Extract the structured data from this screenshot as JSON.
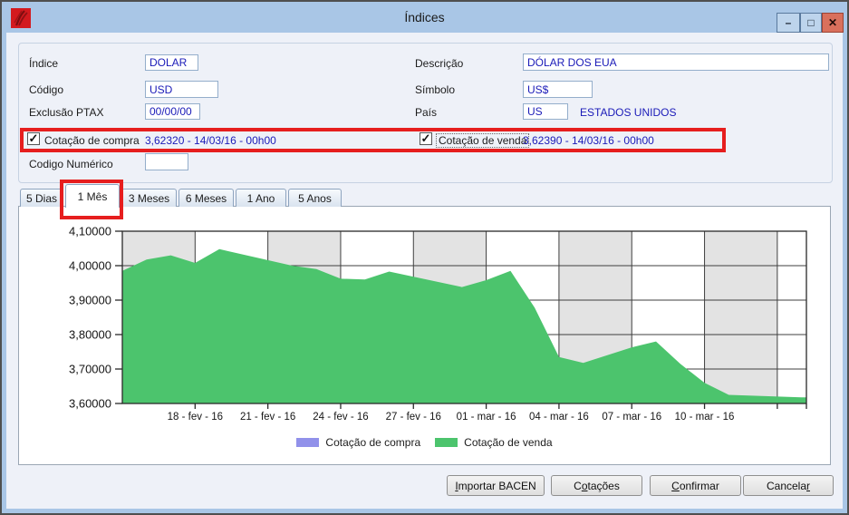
{
  "window": {
    "title": "Índices",
    "icon": "totvs-red-logo",
    "controls": {
      "minimize": "minimize",
      "maximize": "maximize",
      "close": "close"
    }
  },
  "colors": {
    "titlebar": "#a9c6e6",
    "body": "#eef1f8",
    "value_text": "#1a1ab8",
    "highlight_red": "#e61e1e",
    "band_gray": "#e3e3e3",
    "compra_purple": "#9191ea",
    "venda_green": "#4cc46d"
  },
  "form": {
    "indice": {
      "label": "Índice",
      "value": "DOLAR"
    },
    "descricao": {
      "label": "Descrição",
      "value": "DÓLAR DOS EUA"
    },
    "codigo": {
      "label": "Código",
      "value": "USD"
    },
    "simbolo": {
      "label": "Símbolo",
      "value": "US$"
    },
    "exclusao_ptax": {
      "label": "Exclusão PTAX",
      "value": "00/00/00"
    },
    "pais": {
      "label": "País",
      "value": "US",
      "name": "ESTADOS UNIDOS"
    },
    "cotacao_compra": {
      "label": "Cotação de compra",
      "checked": true,
      "value": "3,62320 - 14/03/16 - 00h00"
    },
    "cotacao_venda": {
      "label": "Cotação de venda",
      "checked": true,
      "value": "3,62390 - 14/03/16 - 00h00"
    },
    "codigo_numerico": {
      "label": "Codigo Numérico",
      "value": ""
    }
  },
  "tabs": {
    "items": [
      "5 Dias",
      "1 Mês",
      "3 Meses",
      "6 Meses",
      "1 Ano",
      "5 Anos"
    ],
    "active": "1 Mês"
  },
  "chart_data": {
    "type": "area",
    "title": "",
    "xlabel": "",
    "ylabel": "",
    "ylim": [
      3.6,
      4.1
    ],
    "grid": true,
    "legend_position": "bottom",
    "yticks": [
      {
        "v": 4.1,
        "label": "4,10000"
      },
      {
        "v": 4.0,
        "label": "4,00000"
      },
      {
        "v": 3.9,
        "label": "3,90000"
      },
      {
        "v": 3.8,
        "label": "3,80000"
      },
      {
        "v": 3.7,
        "label": "3,70000"
      },
      {
        "v": 3.6,
        "label": "3,60000"
      }
    ],
    "xticks": [
      {
        "day": 3,
        "label": "18 - fev - 16"
      },
      {
        "day": 6,
        "label": "21 - fev - 16"
      },
      {
        "day": 9,
        "label": "24 - fev - 16"
      },
      {
        "day": 12,
        "label": "27 - fev - 16"
      },
      {
        "day": 15,
        "label": "01 - mar - 16"
      },
      {
        "day": 18,
        "label": "04 - mar - 16"
      },
      {
        "day": 21,
        "label": "07 - mar - 16"
      },
      {
        "day": 24,
        "label": "10 - mar - 16"
      },
      {
        "day": 27,
        "label": ""
      }
    ],
    "day_range": [
      0,
      28.2
    ],
    "gray_bands_days": [
      [
        0,
        3
      ],
      [
        6,
        9
      ],
      [
        12,
        15
      ],
      [
        18,
        21
      ],
      [
        24,
        27
      ]
    ],
    "series": [
      {
        "name": "Cotação de compra",
        "color": "#9191ea",
        "points": [
          [
            0,
            3.983
          ],
          [
            1,
            4.016
          ],
          [
            2,
            4.028
          ],
          [
            3,
            4.006
          ],
          [
            4,
            4.046
          ],
          [
            7,
            3.998
          ],
          [
            8,
            3.988
          ],
          [
            9,
            3.96
          ],
          [
            10,
            3.958
          ],
          [
            11,
            3.981
          ],
          [
            14,
            3.936
          ],
          [
            15,
            3.956
          ],
          [
            16,
            3.983
          ],
          [
            17,
            3.876
          ],
          [
            18,
            3.733
          ],
          [
            19,
            3.716
          ],
          [
            21,
            3.761
          ],
          [
            22,
            3.778
          ],
          [
            23,
            3.713
          ],
          [
            24,
            3.658
          ],
          [
            25,
            3.623
          ],
          [
            28,
            3.616
          ],
          [
            28.2,
            3.616
          ]
        ]
      },
      {
        "name": "Cotação de venda",
        "color": "#4cc46d",
        "points": [
          [
            0,
            3.985
          ],
          [
            1,
            4.018
          ],
          [
            2,
            4.03
          ],
          [
            3,
            4.008
          ],
          [
            4,
            4.048
          ],
          [
            7,
            4.0
          ],
          [
            8,
            3.99
          ],
          [
            9,
            3.962
          ],
          [
            10,
            3.96
          ],
          [
            11,
            3.983
          ],
          [
            14,
            3.938
          ],
          [
            15,
            3.958
          ],
          [
            16,
            3.985
          ],
          [
            17,
            3.878
          ],
          [
            18,
            3.735
          ],
          [
            19,
            3.718
          ],
          [
            21,
            3.763
          ],
          [
            22,
            3.78
          ],
          [
            23,
            3.715
          ],
          [
            24,
            3.66
          ],
          [
            25,
            3.625
          ],
          [
            28,
            3.618
          ],
          [
            28.2,
            3.618
          ]
        ]
      }
    ]
  },
  "buttons": [
    {
      "label": "Importar BACEN",
      "accel": "I"
    },
    {
      "label": "Cotações",
      "accel": "o"
    },
    {
      "label": "Confirmar",
      "accel": "C"
    },
    {
      "label": "Cancelar",
      "accel": "r"
    }
  ]
}
